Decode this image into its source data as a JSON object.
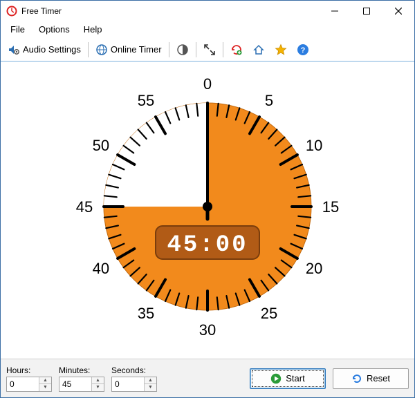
{
  "window": {
    "title": "Free Timer"
  },
  "menu": {
    "file": "File",
    "options": "Options",
    "help": "Help"
  },
  "toolbar": {
    "audio_settings": "Audio Settings",
    "online_timer": "Online Timer"
  },
  "dial": {
    "labels": [
      "0",
      "5",
      "10",
      "15",
      "20",
      "25",
      "30",
      "35",
      "40",
      "45",
      "50",
      "55"
    ],
    "digital": "45:00",
    "minutesSet": 45,
    "colors": {
      "fill": "#f28a1c",
      "digitalBg": "#b15b16",
      "face": "#ffffff"
    }
  },
  "inputs": {
    "hours": {
      "label": "Hours:",
      "value": "0"
    },
    "minutes": {
      "label": "Minutes:",
      "value": "45"
    },
    "seconds": {
      "label": "Seconds:",
      "value": "0"
    }
  },
  "buttons": {
    "start": "Start",
    "reset": "Reset"
  }
}
